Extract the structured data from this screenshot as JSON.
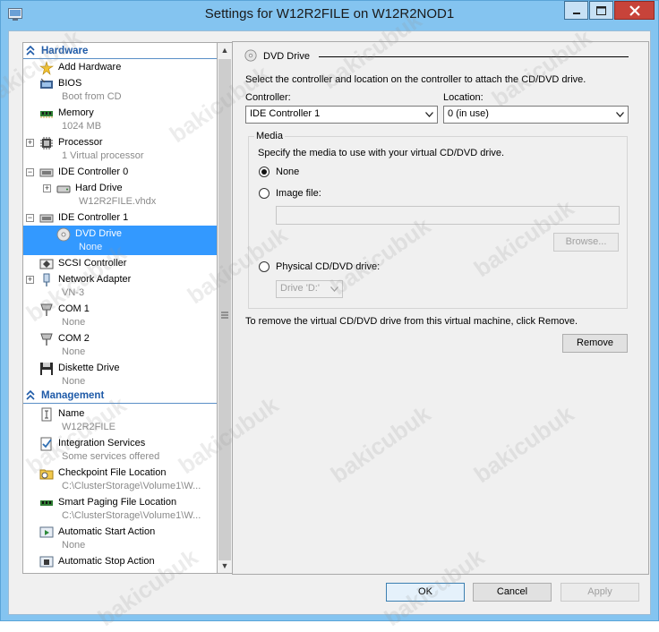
{
  "window": {
    "title": "Settings for W12R2FILE on W12R2NOD1",
    "controls": [
      "minimize-icon",
      "maximize-icon",
      "close-icon"
    ]
  },
  "tree": {
    "hardware_header": "Hardware",
    "management_header": "Management",
    "items": [
      {
        "name": "Add Hardware",
        "sub": "",
        "icon": "add-hardware-icon"
      },
      {
        "name": "BIOS",
        "sub": "Boot from CD",
        "icon": "bios-icon"
      },
      {
        "name": "Memory",
        "sub": "1024 MB",
        "icon": "memory-icon"
      },
      {
        "name": "Processor",
        "sub": "1 Virtual processor",
        "icon": "processor-icon"
      },
      {
        "name": "IDE Controller 0",
        "sub": "",
        "icon": "ide-controller-icon"
      },
      {
        "name": "Hard Drive",
        "sub": "W12R2FILE.vhdx",
        "icon": "hard-drive-icon"
      },
      {
        "name": "IDE Controller 1",
        "sub": "",
        "icon": "ide-controller-icon"
      },
      {
        "name": "DVD Drive",
        "sub": "None",
        "icon": "dvd-drive-icon"
      },
      {
        "name": "SCSI Controller",
        "sub": "",
        "icon": "scsi-controller-icon"
      },
      {
        "name": "Network Adapter",
        "sub": "VN-3",
        "icon": "network-adapter-icon"
      },
      {
        "name": "COM 1",
        "sub": "None",
        "icon": "com-port-icon"
      },
      {
        "name": "COM 2",
        "sub": "None",
        "icon": "com-port-icon"
      },
      {
        "name": "Diskette Drive",
        "sub": "None",
        "icon": "diskette-icon"
      }
    ],
    "management_items": [
      {
        "name": "Name",
        "sub": "W12R2FILE",
        "icon": "name-icon"
      },
      {
        "name": "Integration Services",
        "sub": "Some services offered",
        "icon": "integration-services-icon"
      },
      {
        "name": "Checkpoint File Location",
        "sub": "C:\\ClusterStorage\\Volume1\\W...",
        "icon": "checkpoint-icon"
      },
      {
        "name": "Smart Paging File Location",
        "sub": "C:\\ClusterStorage\\Volume1\\W...",
        "icon": "smart-paging-icon"
      },
      {
        "name": "Automatic Start Action",
        "sub": "None",
        "icon": "auto-start-icon"
      },
      {
        "name": "Automatic Stop Action",
        "sub": "",
        "icon": "auto-stop-icon"
      }
    ],
    "selected": "DVD Drive"
  },
  "panel": {
    "heading": "DVD Drive",
    "intro": "Select the controller and location on the controller to attach the CD/DVD drive.",
    "controller_label": "Controller:",
    "controller_value": "IDE Controller 1",
    "location_label": "Location:",
    "location_value": "0 (in use)",
    "media_group": "Media",
    "media_intro": "Specify the media to use with your virtual CD/DVD drive.",
    "opt_none": "None",
    "opt_image": "Image file:",
    "image_path": "",
    "browse": "Browse...",
    "opt_physical": "Physical CD/DVD drive:",
    "physical_value": "Drive 'D:'",
    "remove_note": "To remove the virtual CD/DVD drive from this virtual machine, click Remove.",
    "remove": "Remove"
  },
  "footer": {
    "ok": "OK",
    "cancel": "Cancel",
    "apply": "Apply"
  },
  "watermark": "bakicubuk"
}
